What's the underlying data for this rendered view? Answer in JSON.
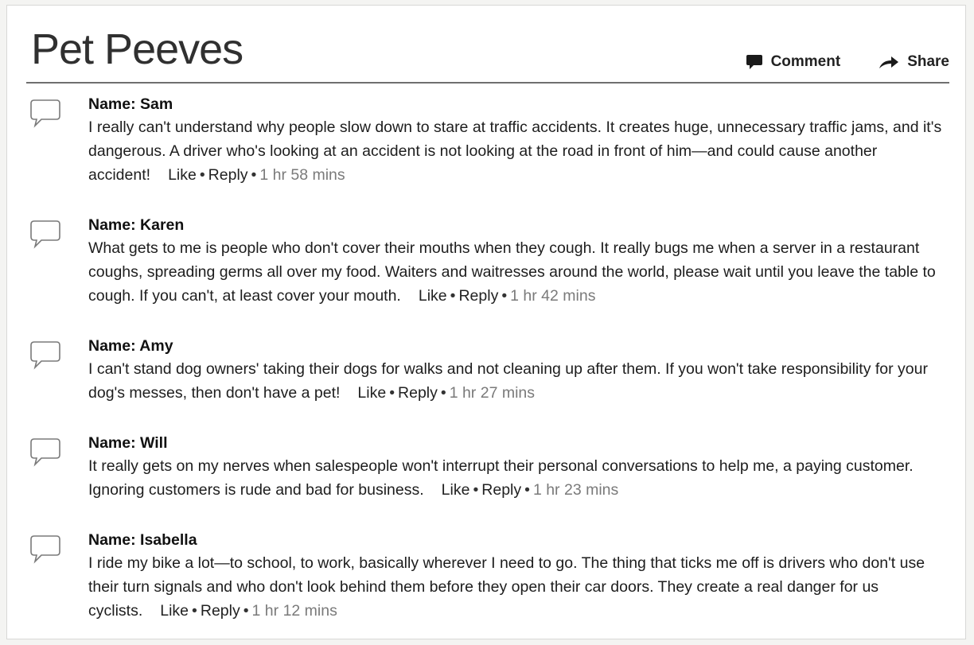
{
  "page": {
    "title": "Pet Peeves",
    "comment_label": "Comment",
    "share_label": "Share"
  },
  "comments": [
    {
      "name": "Name: Sam",
      "text": "I really can't understand why people slow down to stare at traffic accidents. It creates huge, unnecessary traffic jams, and it's dangerous. A driver who's looking at an accident is not looking at the road in front of him—and could cause another accident!",
      "like": "Like",
      "reply": "Reply",
      "time": "1 hr 58 mins"
    },
    {
      "name": "Name: Karen",
      "text": "What gets to me is people who don't cover their mouths when they cough. It really bugs me when a server in a restaurant coughs, spreading germs all over my food. Waiters and waitresses around the world, please wait until you leave the table to cough. If you can't, at least cover your mouth.",
      "like": "Like",
      "reply": "Reply",
      "time": "1 hr 42 mins"
    },
    {
      "name": "Name: Amy",
      "text": "I can't stand dog owners' taking their dogs for walks and not cleaning up after them. If you won't take responsibility for your dog's messes, then don't have a pet!",
      "like": "Like",
      "reply": "Reply",
      "time": "1 hr 27 mins"
    },
    {
      "name": "Name: Will",
      "text": "It really gets on my nerves when salespeople won't interrupt their personal conversations to help me, a paying customer. Ignoring customers is rude and bad for business.",
      "like": "Like",
      "reply": "Reply",
      "time": "1 hr 23 mins"
    },
    {
      "name": "Name: Isabella",
      "text": "I ride my bike a lot—to school, to work, basically wherever I need to go. The thing that ticks me off is drivers who don't use their turn signals and who don't look behind them before they open their car doors. They create a real danger for us cyclists.",
      "like": "Like",
      "reply": "Reply",
      "time": "1 hr 12 mins"
    }
  ]
}
